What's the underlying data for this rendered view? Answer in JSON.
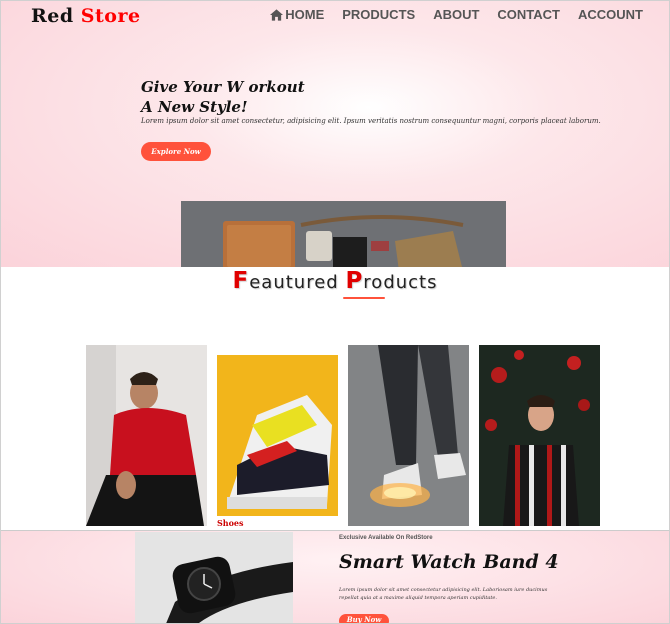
{
  "brand": {
    "part1": "Red",
    "part2": "Store"
  },
  "nav": {
    "items": [
      {
        "label": "HOME",
        "icon": "home-icon"
      },
      {
        "label": "PRODUCTS"
      },
      {
        "label": "ABOUT"
      },
      {
        "label": "CONTACT"
      },
      {
        "label": "ACCOUNT"
      }
    ]
  },
  "hero": {
    "title_line1": "Give Your W orkout",
    "title_line2": "A New Style!",
    "description": "Lorem ipsum dolor sit amet consectetur, adipisicing elit. Ipsum veritatis nostrum consequuntur magni, corporis placeat laborum.",
    "button": "Explore Now"
  },
  "featured": {
    "title_cap1": "F",
    "title_rest1": "eautured ",
    "title_cap2": "P",
    "title_rest2": "roducts",
    "products": [
      {
        "label": ""
      },
      {
        "label": "Shoes"
      },
      {
        "label": ""
      },
      {
        "label": ""
      }
    ]
  },
  "offer": {
    "tag": "Exclusive Available On RedStore",
    "title": "Smart Watch Band 4",
    "description": "Lorem ipsum dolor sit amet consectetur adipisicing elit. Laboriosam iure ducimus repellat quia at a maxime aliquid tempora aperiam cupiditate.",
    "button": "Buy Now"
  },
  "colors": {
    "accent": "#ff523b",
    "brand_red": "#ff0000",
    "hero_bg": "#fbd3da"
  }
}
